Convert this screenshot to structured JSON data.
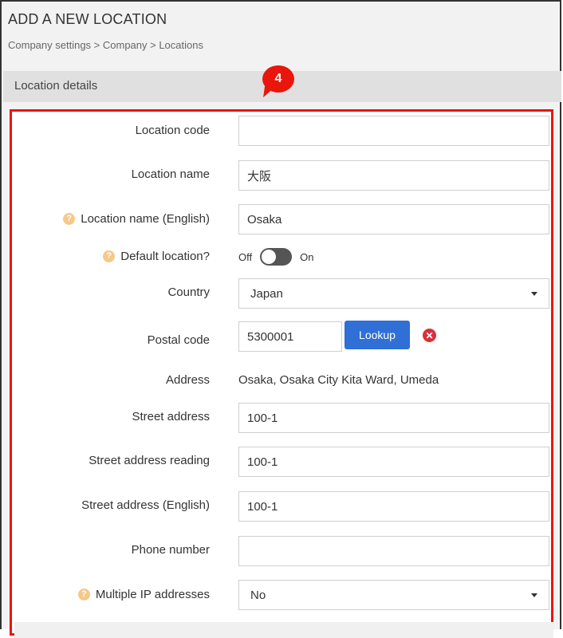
{
  "header": {
    "title": "ADD A NEW LOCATION",
    "breadcrumb": "Company settings > Company > Locations"
  },
  "section": {
    "title": "Location details",
    "step_badge": "4"
  },
  "form": {
    "location_code": {
      "label": "Location code",
      "value": ""
    },
    "location_name": {
      "label": "Location name",
      "value": "大阪"
    },
    "location_name_en": {
      "label": "Location name (English)",
      "value": "Osaka"
    },
    "default_location": {
      "label": "Default location?",
      "off_label": "Off",
      "on_label": "On",
      "state": "off"
    },
    "country": {
      "label": "Country",
      "value": "Japan"
    },
    "postal_code": {
      "label": "Postal code",
      "value": "5300001",
      "lookup_label": "Lookup"
    },
    "address": {
      "label": "Address",
      "value": "Osaka, Osaka City Kita Ward, Umeda"
    },
    "street_address": {
      "label": "Street address",
      "value": "100-1"
    },
    "street_address_reading": {
      "label": "Street address reading",
      "value": "100-1"
    },
    "street_address_en": {
      "label": "Street address (English)",
      "value": "100-1"
    },
    "phone_number": {
      "label": "Phone number",
      "value": ""
    },
    "multiple_ip": {
      "label": "Multiple IP addresses",
      "value": "No"
    }
  },
  "colors": {
    "highlight": "#e8160d",
    "primary_button": "#2f6fd6",
    "help_icon": "#f6c88a",
    "clear_icon": "#d9303a"
  },
  "icons": {
    "help": "question-circle-icon",
    "clear": "times-circle-icon",
    "dropdown": "caret-down-icon"
  }
}
